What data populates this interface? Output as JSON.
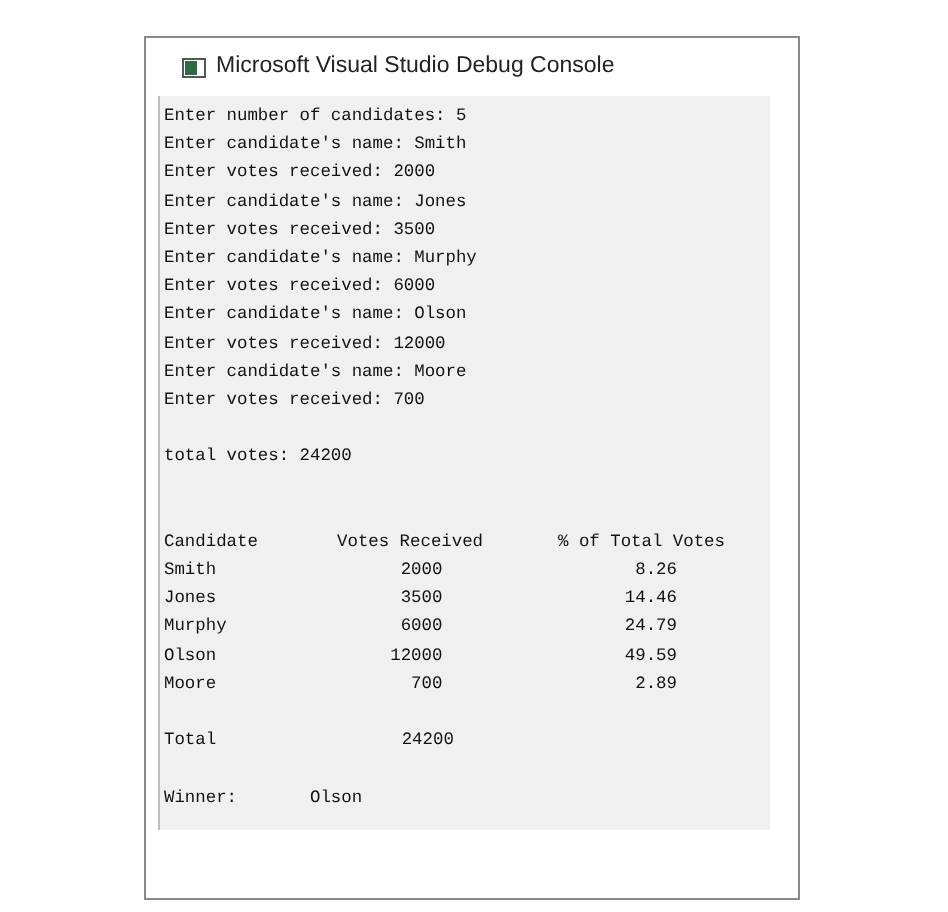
{
  "window": {
    "title": "Microsoft Visual Studio Debug Console"
  },
  "input_lines": [
    "Enter number of candidates: 5",
    "Enter candidate's name: Smith",
    "Enter votes received: 2000",
    "Enter candidate's name: Jones",
    "Enter votes received: 3500",
    "Enter candidate's name: Murphy",
    "Enter votes received: 6000",
    "Enter candidate's name: Olson",
    "Enter votes received: 12000",
    "Enter candidate's name: Moore",
    "Enter votes received: 700"
  ],
  "total_line": "total votes: 24200",
  "table": {
    "columns": [
      "Candidate",
      "Votes Received",
      "% of Total Votes"
    ],
    "rows": [
      [
        "Smith",
        "2000",
        "8.26"
      ],
      [
        "Jones",
        "3500",
        "14.46"
      ],
      [
        "Murphy",
        "6000",
        "24.79"
      ],
      [
        "Olson",
        "12000",
        "49.59"
      ],
      [
        "Moore",
        "700",
        "2.89"
      ]
    ],
    "total": {
      "label": "Total",
      "value": "24200"
    }
  },
  "winner": {
    "label": "Winner:",
    "value": "Olson"
  }
}
